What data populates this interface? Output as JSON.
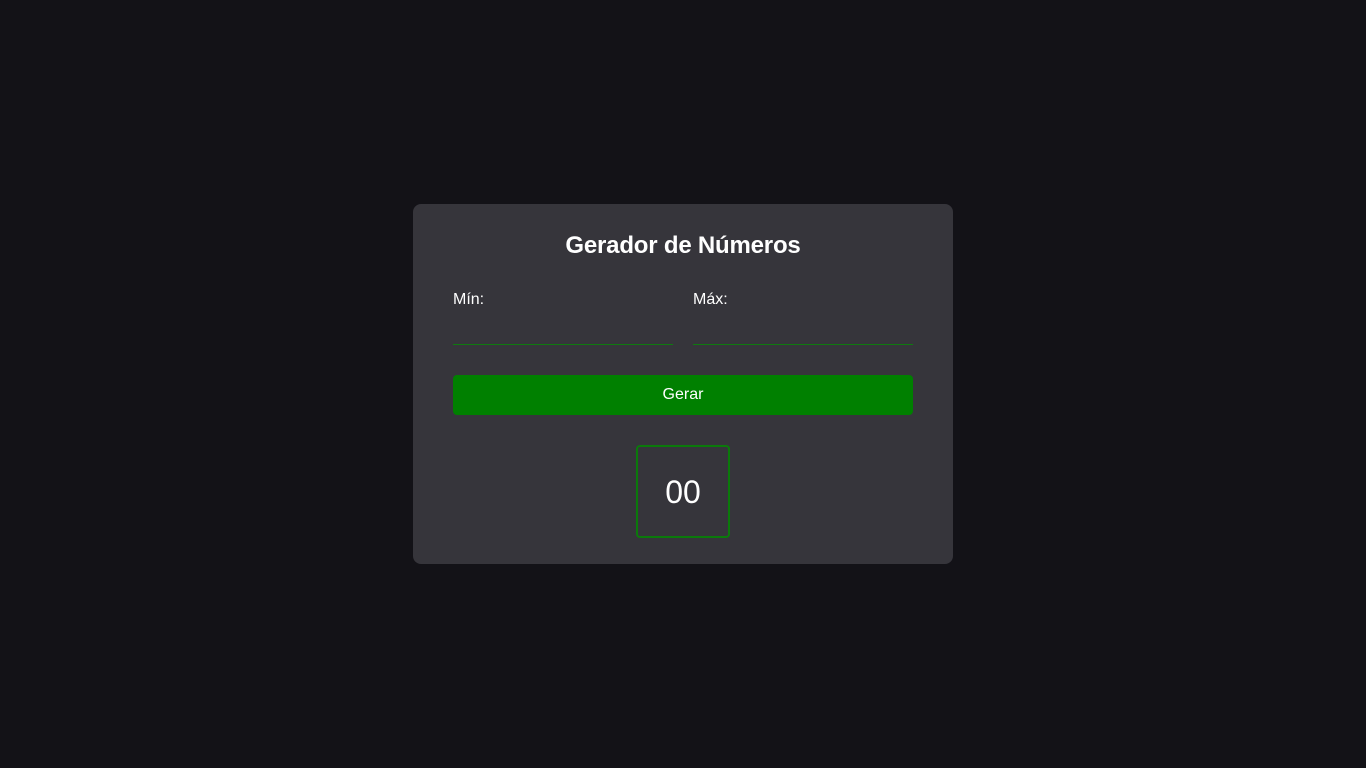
{
  "card": {
    "title": "Gerador de Números"
  },
  "fields": {
    "min": {
      "label": "Mín:",
      "value": "",
      "placeholder": ""
    },
    "max": {
      "label": "Máx:",
      "value": "",
      "placeholder": ""
    }
  },
  "generate_button": {
    "label": "Gerar"
  },
  "result": {
    "value": "00"
  },
  "colors": {
    "background": "#131217",
    "card": "#36353b",
    "accent": "#008000",
    "text": "#ffffff"
  }
}
